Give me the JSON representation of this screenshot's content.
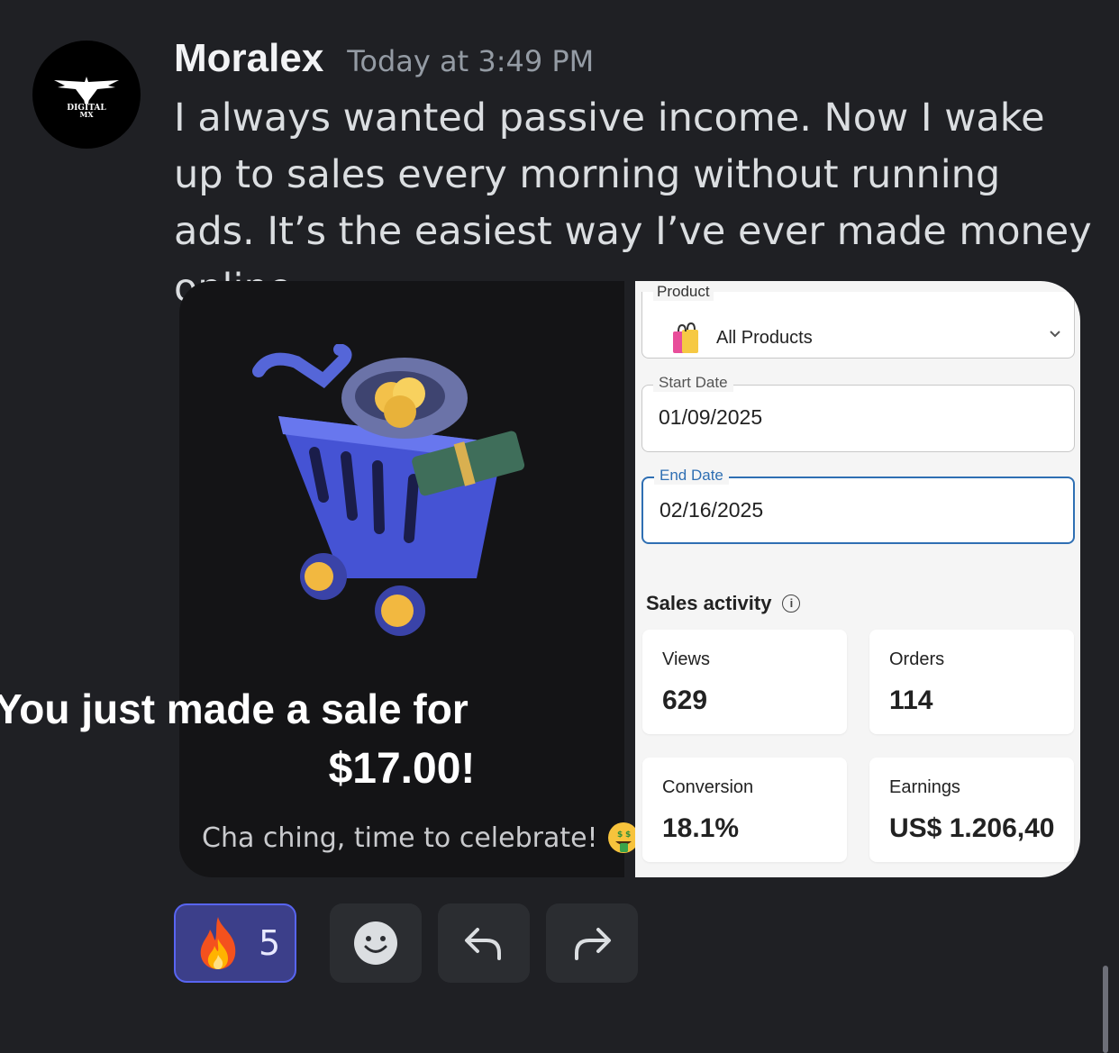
{
  "message": {
    "username": "Moralex",
    "timestamp": "Today at 3:49 PM",
    "text": "I always wanted passive income. Now I wake up to sales every morning without running ads. It’s the easiest way I’ve ever made money online.",
    "avatar_text": [
      "DIGITAL",
      "MX"
    ]
  },
  "sale_card": {
    "title": "You just made a sale for",
    "amount": "$17.00!",
    "subtitle": "Cha ching, time to celebrate!",
    "subtitle_emoji": "money-mouth-face-icon"
  },
  "dashboard": {
    "product_label": "Product",
    "product_value": "All Products",
    "start_date_label": "Start Date",
    "start_date_value": "01/09/2025",
    "end_date_label": "End Date",
    "end_date_value": "02/16/2025",
    "section_title": "Sales activity",
    "stats": [
      {
        "label": "Views",
        "value": "629"
      },
      {
        "label": "Orders",
        "value": "114"
      },
      {
        "label": "Conversion",
        "value": "18.1%"
      },
      {
        "label": "Earnings",
        "value": "US$ 1.206,40"
      }
    ],
    "accent_color": "#2f6fb3"
  },
  "reactions": {
    "fire_count": "5",
    "fire_icon": "fire-icon",
    "actions": [
      "add-reaction-icon",
      "reply-icon",
      "forward-icon"
    ]
  },
  "colors": {
    "background": "#1f2024",
    "reaction_active_border": "#5865f2"
  }
}
